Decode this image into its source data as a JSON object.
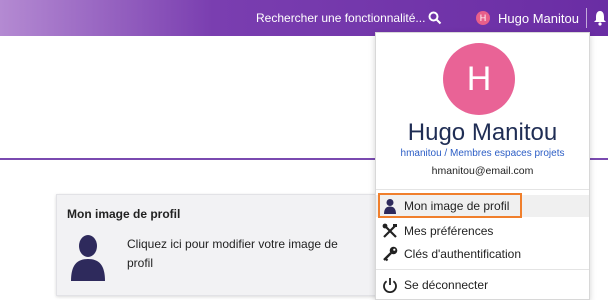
{
  "header": {
    "search_label": "Rechercher une fonctionnalité...",
    "search_icon": "search-icon",
    "user_initial": "H",
    "user_name": "Hugo Manitou",
    "bell_icon": "bell-icon"
  },
  "colors": {
    "header_gradient_start": "#b48ad2",
    "header_gradient_end": "#6a2da4",
    "avatar": "#e96396",
    "highlight_border": "#f07f2c",
    "name_text": "#1f2d54",
    "link_text": "#2c5ec6"
  },
  "card": {
    "title": "Mon image de profil",
    "description": "Cliquez ici pour modifier votre image de profil",
    "icon": "user-silhouette-icon"
  },
  "dropdown": {
    "avatar_initial": "H",
    "name": "Hugo Manitou",
    "subtitle": "hmanitou / Membres espaces projets",
    "email": "hmanitou@email.com",
    "items": [
      {
        "label": "Mon image de profil",
        "icon": "user-icon",
        "highlighted": true
      },
      {
        "label": "Mes préférences",
        "icon": "tools-icon"
      },
      {
        "label": "Clés d'authentification",
        "icon": "key-icon"
      }
    ],
    "logout": {
      "label": "Se déconnecter",
      "icon": "power-icon"
    }
  }
}
